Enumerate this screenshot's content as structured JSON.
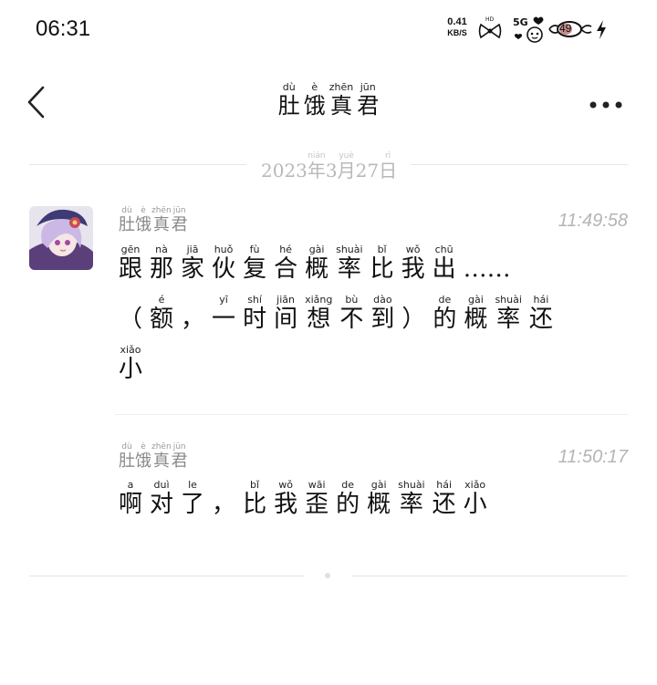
{
  "status_bar": {
    "time": "06:31",
    "net_speed_value": "0.41",
    "net_speed_unit": "KB/S",
    "hd_label": "HD",
    "signal_label": "5G",
    "battery_level": "49"
  },
  "header": {
    "title_chars": [
      "肚",
      "饿",
      "真",
      "君"
    ],
    "title_pinyin": [
      "dù",
      "è",
      "zhēn",
      "jūn"
    ]
  },
  "date_divider": {
    "year": "2023",
    "year_char": "年",
    "year_pinyin": "nián",
    "month": "3",
    "month_char": "月",
    "month_pinyin": "yuè",
    "day": "27",
    "day_char": "日",
    "day_pinyin": "rì"
  },
  "messages": [
    {
      "sender_chars": [
        "肚",
        "饿",
        "真",
        "君"
      ],
      "sender_pinyin": [
        "dù",
        "è",
        "zhēn",
        "jūn"
      ],
      "time": "11:49:58",
      "line1_chars": [
        "跟",
        "那",
        "家",
        "伙",
        "复",
        "合",
        "概",
        "率",
        "比",
        "我",
        "出"
      ],
      "line1_pinyin": [
        "gēn",
        "nà",
        "jiā",
        "huǒ",
        "fù",
        "hé",
        "gài",
        "shuài",
        "bǐ",
        "wǒ",
        "chū"
      ],
      "line1_tail": "……",
      "line2_chars": [
        "（",
        "额",
        "，",
        "一",
        "时",
        "间",
        "想",
        "不",
        "到",
        "）",
        "的",
        "概",
        "率",
        "还"
      ],
      "line2_pinyin": [
        "",
        "é",
        "",
        "yī",
        "shí",
        "jiān",
        "xiǎng",
        "bù",
        "dào",
        "",
        "de",
        "gài",
        "shuài",
        "hái"
      ],
      "line3_chars": [
        "小"
      ],
      "line3_pinyin": [
        "xiǎo"
      ]
    },
    {
      "sender_chars": [
        "肚",
        "饿",
        "真",
        "君"
      ],
      "sender_pinyin": [
        "dù",
        "è",
        "zhēn",
        "jūn"
      ],
      "time": "11:50:17",
      "line1_chars": [
        "啊",
        "对",
        "了",
        "，",
        "比",
        "我",
        "歪",
        "的",
        "概",
        "率",
        "还",
        "小"
      ],
      "line1_pinyin": [
        "a",
        "duì",
        "le",
        "",
        "bǐ",
        "wǒ",
        "wāi",
        "de",
        "gài",
        "shuài",
        "hái",
        "xiǎo"
      ]
    }
  ]
}
